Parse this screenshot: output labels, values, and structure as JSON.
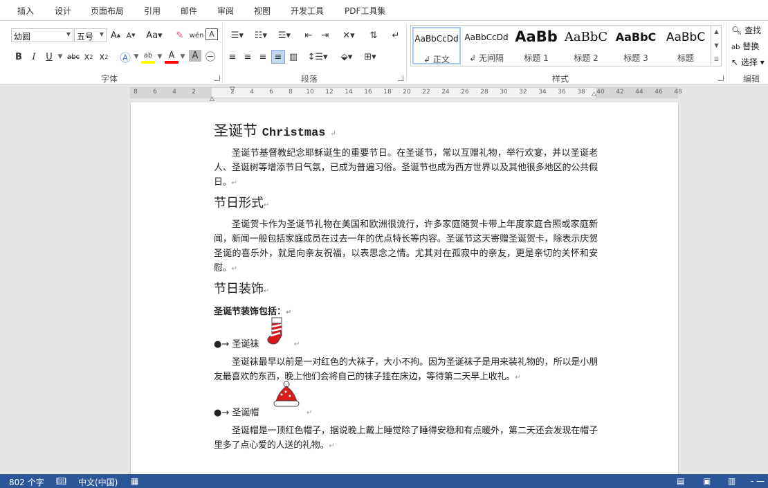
{
  "tabs": [
    "插入",
    "设计",
    "页面布局",
    "引用",
    "邮件",
    "审阅",
    "视图",
    "开发工具",
    "PDF工具集"
  ],
  "font_group": {
    "label": "字体",
    "font_name": "幼圆",
    "font_size": "五号"
  },
  "paragraph_group": {
    "label": "段落"
  },
  "styles_group": {
    "label": "样式",
    "items": [
      {
        "sample": "AaBbCcDd",
        "name": "正文"
      },
      {
        "sample": "AaBbCcDd",
        "name": "无间隔"
      },
      {
        "sample": "AaBb",
        "name": "标题 1"
      },
      {
        "sample": "AaBbC",
        "name": "标题 2"
      },
      {
        "sample": "AaBbC",
        "name": "标题 3"
      },
      {
        "sample": "AaBbC",
        "name": "标题"
      }
    ]
  },
  "editing_group": {
    "label": "编辑",
    "find": "查找",
    "replace": "替换",
    "select": "选择"
  },
  "ruler_ticks": [
    "8",
    "6",
    "4",
    "2",
    "",
    "2",
    "4",
    "6",
    "8",
    "10",
    "12",
    "14",
    "16",
    "18",
    "20",
    "22",
    "24",
    "26",
    "28",
    "30",
    "32",
    "34",
    "36",
    "38",
    "40",
    "42",
    "44",
    "46",
    "48"
  ],
  "document": {
    "title_cn": "圣诞节",
    "title_en": "Christmas",
    "p1": "圣诞节基督教纪念耶稣诞生的重要节日。在圣诞节，常以互赠礼物，举行欢宴，并以圣诞老人、圣诞树等增添节日气氛，已成为普遍习俗。圣诞节也成为西方世界以及其他很多地区的公共假日。",
    "h_form": "节日形式",
    "p2": "圣诞贺卡作为圣诞节礼物在美国和欧洲很流行，许多家庭随贺卡带上年度家庭合照或家庭新闻，新闻一般包括家庭成员在过去一年的优点特长等内容。圣诞节这天寄赠圣诞贺卡，除表示庆贺圣诞的喜乐外，就是向亲友祝福，以表思念之情。尤其对在孤寂中的亲友，更是亲切的关怀和安慰。",
    "h_decor": "节日装饰",
    "decor_intro": "圣诞节装饰包括：",
    "item1": "圣诞袜",
    "p3": "圣诞袜最早以前是一对红色的大袜子，大小不拘。因为圣诞袜子是用来装礼物的，所以是小朋友最喜欢的东西，晚上他们会将自己的袜子挂在床边，等待第二天早上收礼。",
    "item2": "圣诞帽",
    "p4": "圣诞帽是一顶红色帽子，据说晚上戴上睡觉除了睡得安稳和有点暖外，第二天还会发现在帽子里多了点心爱的人送的礼物。"
  },
  "status": {
    "word_count": "802 个字",
    "language": "中文(中国)"
  },
  "colors": {
    "status_bar": "#2b579a",
    "highlight": "#ffff00",
    "font_color": "#ff0000",
    "stocking_red": "#d8161b",
    "hat_red": "#d91e18"
  }
}
